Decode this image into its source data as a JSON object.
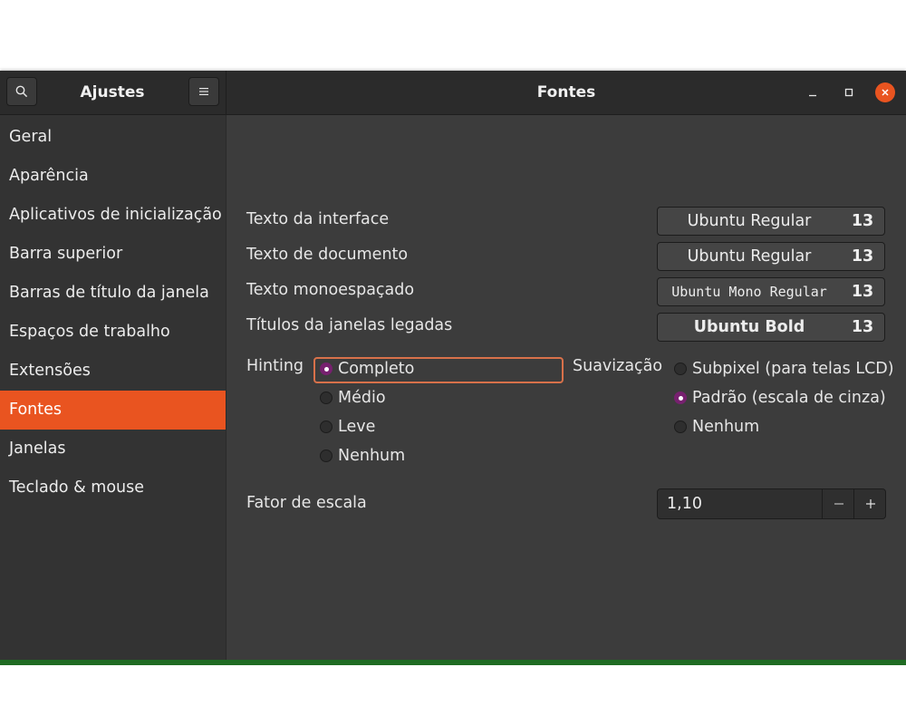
{
  "header": {
    "sidebar_title": "Ajustes",
    "title": "Fontes",
    "icons": {
      "search": "search-icon",
      "menu": "hamburger-menu-icon",
      "minimize": "minimize-icon",
      "maximize": "maximize-icon",
      "close": "close-icon"
    }
  },
  "sidebar": {
    "items": [
      {
        "label": "Geral"
      },
      {
        "label": "Aparência"
      },
      {
        "label": "Aplicativos de inicialização"
      },
      {
        "label": "Barra superior"
      },
      {
        "label": "Barras de título da janela"
      },
      {
        "label": "Espaços de trabalho"
      },
      {
        "label": "Extensões"
      },
      {
        "label": "Fontes",
        "active": true
      },
      {
        "label": "Janelas"
      },
      {
        "label": "Teclado & mouse"
      }
    ]
  },
  "fonts": {
    "rows": [
      {
        "label": "Texto da interface",
        "font": "Ubuntu Regular",
        "size": "13"
      },
      {
        "label": "Texto de documento",
        "font": "Ubuntu Regular",
        "size": "13"
      },
      {
        "label": "Texto monoespaçado",
        "font": "Ubuntu Mono Regular",
        "size": "13"
      },
      {
        "label": "Títulos da janelas legadas",
        "font": "Ubuntu Bold",
        "size": "13"
      }
    ]
  },
  "hinting": {
    "label": "Hinting",
    "options": [
      "Completo",
      "Médio",
      "Leve",
      "Nenhum"
    ],
    "selected": "Completo"
  },
  "antialiasing": {
    "label": "Suavização",
    "options": [
      "Subpixel (para telas LCD)",
      "Padrão (escala de cinza)",
      "Nenhum"
    ],
    "selected": "Padrão (escala de cinza)"
  },
  "scale": {
    "label": "Fator de escala",
    "value": "1,10",
    "decrement": "−",
    "increment": "+"
  },
  "colors": {
    "accent": "#e95420",
    "radio_selected": "#77216f",
    "window_bg": "#3c3c3c",
    "sidebar_bg": "#333333",
    "header_bg": "#2b2b2b"
  }
}
